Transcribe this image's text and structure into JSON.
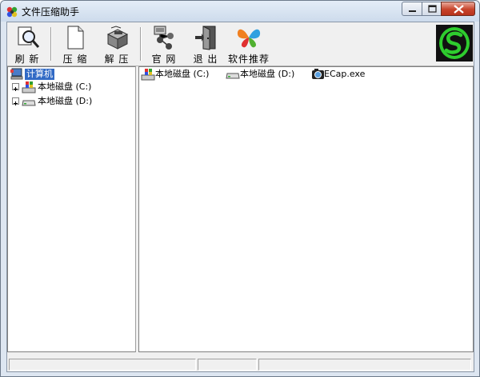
{
  "window": {
    "title": "文件压缩助手",
    "controls": {
      "minimize": "minimize-icon",
      "maximize": "maximize-icon",
      "close": "close-icon"
    }
  },
  "toolbar": {
    "refresh_label": "刷 新",
    "compress_label": "压 缩",
    "decompress_label": "解 压",
    "website_label": "官 网",
    "exit_label": "退 出",
    "recommend_label": "软件推荐"
  },
  "tree": {
    "root": "计算机",
    "nodes": [
      {
        "label": "本地磁盘 (C:)",
        "icon": "windows-drive-icon"
      },
      {
        "label": "本地磁盘 (D:)",
        "icon": "drive-icon"
      }
    ]
  },
  "list": {
    "items": [
      {
        "label": "本地磁盘 (C:)",
        "icon": "windows-drive-icon"
      },
      {
        "label": "本地磁盘 (D:)",
        "icon": "drive-icon"
      },
      {
        "label": "ECap.exe",
        "icon": "camera-exe-icon"
      }
    ]
  },
  "colors": {
    "selection": "#316ac5",
    "logo_green": "#2ecc2e",
    "close_red": "#c7432a"
  }
}
